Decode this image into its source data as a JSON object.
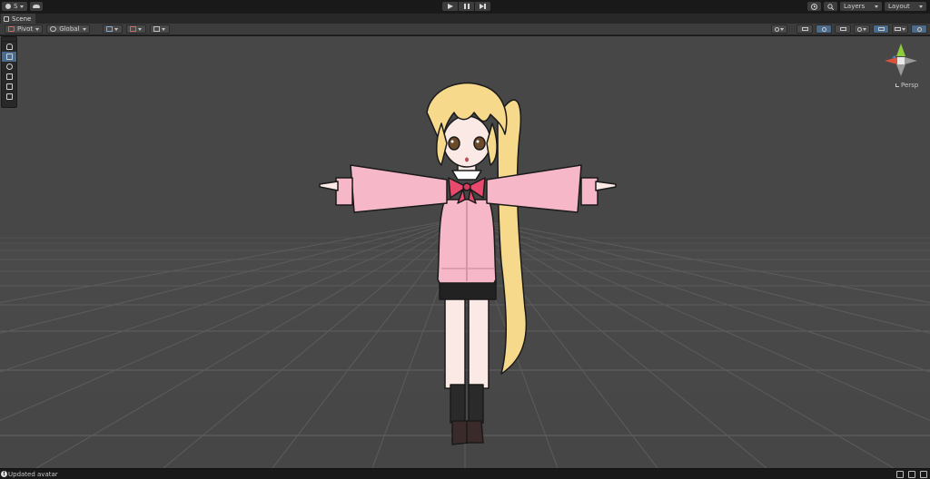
{
  "toolbar": {
    "account_label": "S",
    "layers_label": "Layers",
    "layout_label": "Layout"
  },
  "tabs": {
    "scene_label": "Scene"
  },
  "scene_toolbar": {
    "pivot_label": "Pivot",
    "global_label": "Global"
  },
  "gizmo": {
    "projection_label": "Persp"
  },
  "status": {
    "message": "Updated avatar",
    "icon_glyph": "!"
  },
  "colors": {
    "viewport_bg": "#474747",
    "panel_bg": "#3c3c3c",
    "accent_active": "#4c6a8a",
    "gizmo_x": "#d9533f",
    "gizmo_y": "#8ccb3c",
    "gizmo_z": "#3d83d8"
  }
}
